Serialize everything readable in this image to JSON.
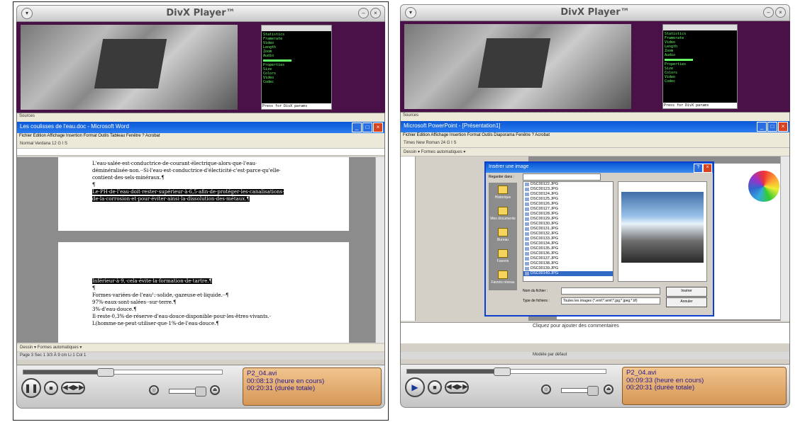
{
  "left": {
    "player": {
      "title": "DivX Player™"
    },
    "stats": {
      "lines": [
        "Statistics",
        "Framerate",
        "Video",
        "Length",
        "Zoom",
        "Audio",
        "",
        "Properties",
        "Size",
        "Colors",
        "Video",
        "Codec"
      ],
      "footer": "Press for DivX params"
    },
    "app": {
      "os_title": "Sources",
      "window_title": "Les coulisses de l'eau.doc - Microsoft Word",
      "menu": "Fichier  Edition  Affichage  Insertion  Format  Outils  Tableau  Fenêtre  ?  Acrobat",
      "toolbar": "Normal   Verdana   12   G  I  S",
      "page1": {
        "line1": "L'eau·salée·est·conductrice·de·courant·électrique·alors·que·l'eau·",
        "line2": "déminéralisée·non.··Si·l'eau·est·conductrice·d'électicité·c'est·parce·qu'elle·",
        "line3": "contient·des·sels·minéraux.¶",
        "line4": "¶",
        "hl1": "Le·PH·de·l'eau·doit·rester·supérieur·à·6,5·afin·de·protéger·les·canalisations·",
        "hl2": "de·la·corrosion·et·pour·éviter·ainsi·la·dissolution·des·métaux.¶"
      },
      "page2": {
        "hl": "Inférieur·à·9,·cela·évite·la·formation·de·tartre.¶",
        "line1": "¶",
        "line2": "Formes·variées·de·l'eau¹:·solide,·gazeuse·et·liquide.··¶",
        "line3": "97%·eaux·sont·salées··sur·terre.¶",
        "line4": "3%·d'eau·douce.¶",
        "line5": "Il·reste·0,3%·de·réserve·d'eau·douce·disponible·pour·les·êtres·vivants.·",
        "line6": "L(homme·ne·peut·utiliser·que·1%·de·l'eau·douce.¶"
      },
      "draw_toolbar": "Dessin ▾  Formes automatiques ▾",
      "status": "Page 3   Sec 1   3/3   À 9 cm   Li 1   Col 1"
    },
    "info": {
      "filename": "P2_04.avi",
      "time": "00:08:13",
      "time_label": "(heure en cours)",
      "total": "00:20:31",
      "total_label": "(durée totale)"
    }
  },
  "right": {
    "player": {
      "title": "DivX Player™"
    },
    "stats": {
      "lines": [
        "Statistics",
        "Framerate",
        "Video",
        "Length",
        "Zoom",
        "Audio",
        "",
        "Properties",
        "Size",
        "Colors",
        "Video",
        "Codec"
      ],
      "footer": "Press for DivX params"
    },
    "app": {
      "os_title": "Sources",
      "window_title": "Microsoft PowerPoint - [Présentation1]",
      "menu": "Fichier  Edition  Affichage  Insertion  Format  Outils  Diaporama  Fenêtre  ?  Acrobat",
      "toolbar": "Times New Roman   24   G  I  S",
      "draw_toolbar": "Dessin ▾  Formes automatiques ▾",
      "notes": "Cliquez pour ajouter des commentaires",
      "status": "Modèle par défaut",
      "dialog": {
        "title": "Insérer une image",
        "look_in_label": "Regarder dans :",
        "look_in_value": "",
        "places": [
          "Historique",
          "Mes documents",
          "Bureau",
          "Favoris",
          "Favoris réseau"
        ],
        "files": [
          "DSC00122.JPG",
          "DSC00123.JPG",
          "DSC00124.JPG",
          "DSC00125.JPG",
          "DSC00126.JPG",
          "DSC00127.JPG",
          "DSC00128.JPG",
          "DSC00129.JPG",
          "DSC00130.JPG",
          "DSC00131.JPG",
          "DSC00132.JPG",
          "DSC00133.JPG",
          "DSC00134.JPG",
          "DSC00135.JPG",
          "DSC00136.JPG",
          "DSC00137.JPG",
          "DSC00138.JPG",
          "DSC00139.JPG",
          "DSC00140.JPG"
        ],
        "filename_label": "Nom du fichier :",
        "filetype_label": "Type de fichiers :",
        "filetype_value": "Toutes les images (*.emf;*.wmf;*.jpg;*.jpeg;*.tif)",
        "insert_button": "Insérer",
        "cancel_button": "Annuler"
      }
    },
    "info": {
      "filename": "P2_04.avi",
      "time": "00:09:33",
      "time_label": "(heure en cours)",
      "total": "00:20:31",
      "total_label": "(durée totale)"
    }
  }
}
